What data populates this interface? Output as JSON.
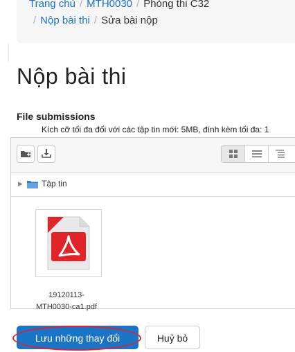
{
  "breadcrumb": {
    "items": [
      "Trang chủ",
      "MTH0030",
      "Phòng thi C32",
      "Nộp bài thi",
      "Sửa bài nộp"
    ],
    "separator": "/"
  },
  "page_title": "Nộp bài thi",
  "file_submissions": {
    "label": "File submissions",
    "limits_text": "Kích cỡ tối đa đối với các tập tin mới: 5MB, đính kèm tối đa: 1",
    "toolbar_icons": [
      "add-folder-icon",
      "download-icon"
    ],
    "view_icons": [
      "icons-view-icon",
      "list-view-icon",
      "tree-view-icon"
    ],
    "path_label": "Tập tin",
    "files": [
      {
        "line1": "19120113-",
        "line2": "MTH0030-ca1.pdf",
        "icon": "pdf-file-icon"
      }
    ]
  },
  "buttons": {
    "save": "Lưu những thay đổi",
    "cancel": "Huỷ bỏ"
  },
  "colors": {
    "primary": "#1b74c5",
    "link": "#1a73c7",
    "annotation": "#d7262f",
    "pdf_red": "#e0252a"
  }
}
